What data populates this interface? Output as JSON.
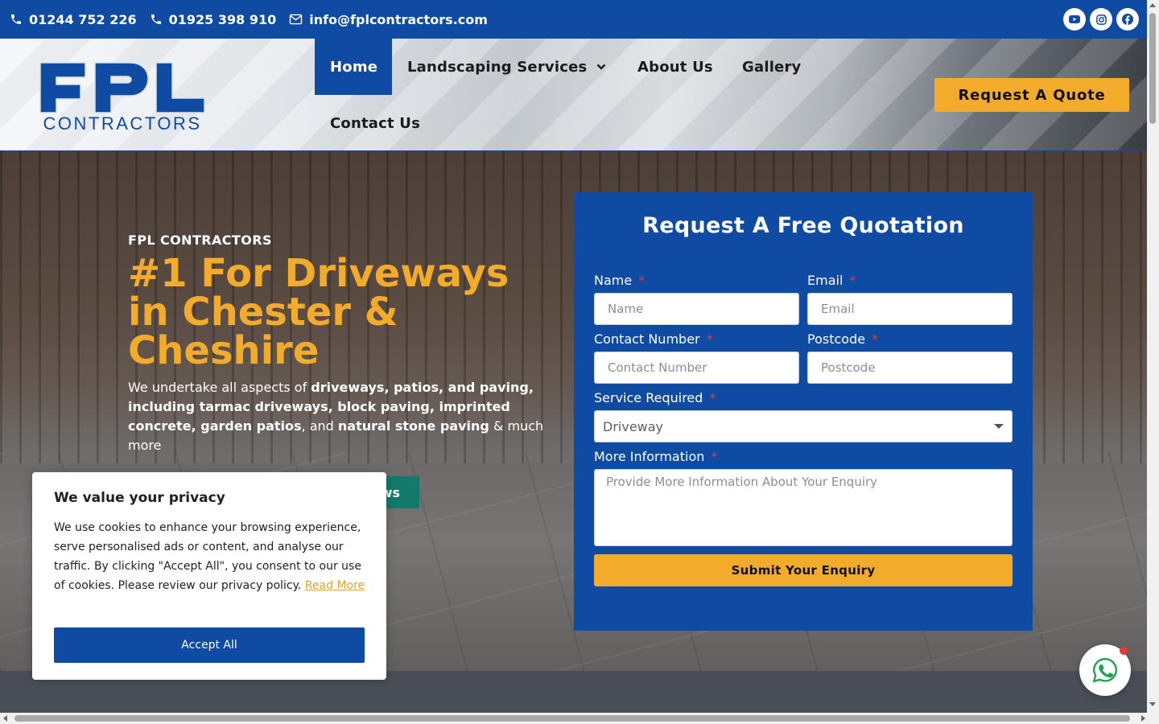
{
  "topbar": {
    "phone1": "01244 752 226",
    "phone2": "01925 398 910",
    "email": "info@fplcontractors.com",
    "socials": [
      "youtube-icon",
      "instagram-icon",
      "facebook-icon"
    ],
    "bg_color": "#0f4aa3"
  },
  "logo": {
    "letters": "FPL",
    "sub": "CONTRACTORS"
  },
  "nav": {
    "items": [
      {
        "label": "Home",
        "active": true
      },
      {
        "label": "Landscaping Services",
        "has_dropdown": true
      },
      {
        "label": "About Us"
      },
      {
        "label": "Gallery"
      },
      {
        "label": "Contact Us"
      }
    ],
    "quote_button": "Request A Quote"
  },
  "hero": {
    "kicker": "FPL CONTRACTORS",
    "title": "#1 For Driveways in Chester & Cheshire",
    "text_parts": [
      "We undertake all aspects of ",
      "driveways, patios, and paving, including tarmac driveways, block paving, imprinted concrete, garden patios",
      ", and ",
      "natural stone paving",
      " & much more"
    ],
    "reviews_button": "ws"
  },
  "form": {
    "title": "Request A Free Quotation",
    "required_marker": "*",
    "name_label": "Name",
    "name_placeholder": "Name",
    "email_label": "Email",
    "email_placeholder": "Email",
    "contact_label": "Contact Number",
    "contact_placeholder": "Contact Number",
    "postcode_label": "Postcode",
    "postcode_placeholder": "Postcode",
    "service_label": "Service Required",
    "service_value": "Driveway",
    "info_label": "More Information",
    "info_placeholder": "Provide More Information About Your Enquiry",
    "submit": "Submit Your Enquiry"
  },
  "cookie": {
    "title": "We value your privacy",
    "text": "We use cookies to enhance your browsing experience, serve personalised ads or content, and analyse our traffic. By clicking \"Accept All\", you consent to our use of cookies. Please review our privacy policy. ",
    "link": "Read More",
    "accept": "Accept All"
  },
  "colors": {
    "brand_blue": "#0f4aa3",
    "accent_orange": "#f2ab2b",
    "teal": "#137a6b"
  },
  "whatsapp": {
    "icon": "whatsapp-icon"
  }
}
